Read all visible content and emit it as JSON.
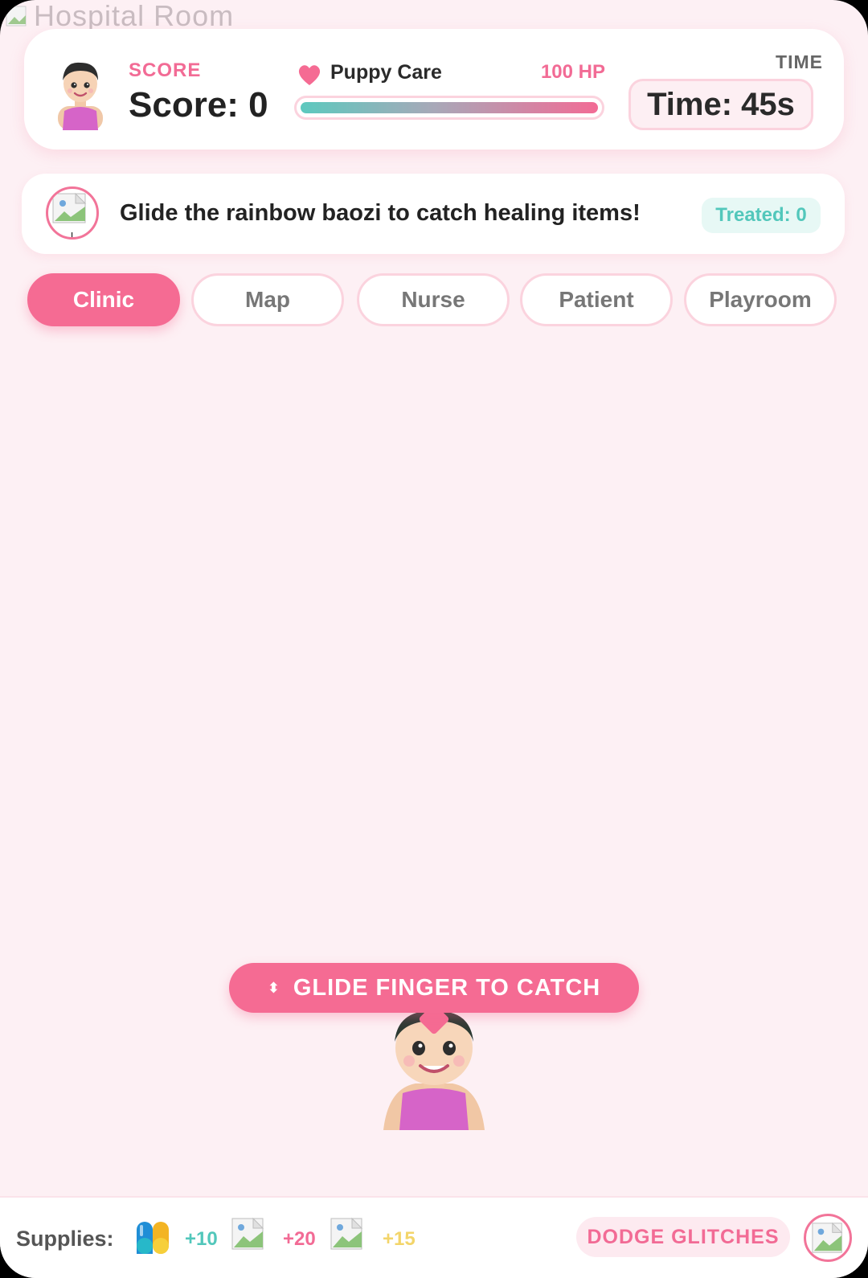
{
  "background_title": "Hospital Room",
  "header": {
    "score_label": "SCORE",
    "score_text": "Score: 0",
    "patient_name": "Puppy Care",
    "hp_text": "100 HP",
    "hp_fraction": 1.0,
    "time_label": "TIME",
    "time_text": "Time: 45s"
  },
  "instruction": {
    "text": "Glide the rainbow baozi to catch healing items!",
    "treated_text": "Treated: 0"
  },
  "tabs": [
    {
      "label": "Clinic",
      "active": true
    },
    {
      "label": "Map",
      "active": false
    },
    {
      "label": "Nurse",
      "active": false
    },
    {
      "label": "Patient",
      "active": false
    },
    {
      "label": "Playroom",
      "active": false
    }
  ],
  "hint": {
    "icon": "up-down-arrows-icon",
    "text": "GLIDE FINGER TO CATCH"
  },
  "supplies": {
    "label": "Supplies:",
    "items": [
      {
        "icon": "pill-capsule-icon",
        "points": "+10",
        "color": "#52c7bb"
      },
      {
        "icon": "broken-image-icon",
        "points": "+20",
        "color": "#f26b95"
      },
      {
        "icon": "broken-image-icon",
        "points": "+15",
        "color": "#f3d56a"
      }
    ],
    "dodge_label": "DODGE GLITCHES"
  },
  "colors": {
    "accent_pink": "#f56b93",
    "teal": "#52c7bb",
    "background": "#fdf0f4"
  }
}
